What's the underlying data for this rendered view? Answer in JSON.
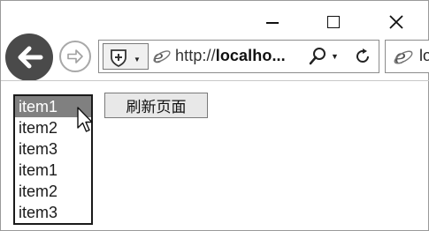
{
  "window": {
    "minimize_icon": "minimize-icon",
    "maximize_icon": "maximize-icon",
    "close_icon": "close-icon"
  },
  "nav": {
    "back_icon": "back-arrow-icon",
    "forward_icon": "forward-arrow-icon"
  },
  "address_bar": {
    "url_prefix": "http://",
    "url_rest": "localho...",
    "security_icon": "shield-plus-icon",
    "search_icon": "search-icon",
    "refresh_icon": "refresh-icon"
  },
  "tab": {
    "title": "lo"
  },
  "page": {
    "listbox": {
      "items": [
        "item1",
        "item2",
        "item3",
        "item1",
        "item2",
        "item3"
      ],
      "selected_index": 0
    },
    "refresh_button_label": "刷新页面"
  },
  "colors": {
    "selected_item_bg": "#808080",
    "back_button_bg": "#4a4a4a"
  }
}
